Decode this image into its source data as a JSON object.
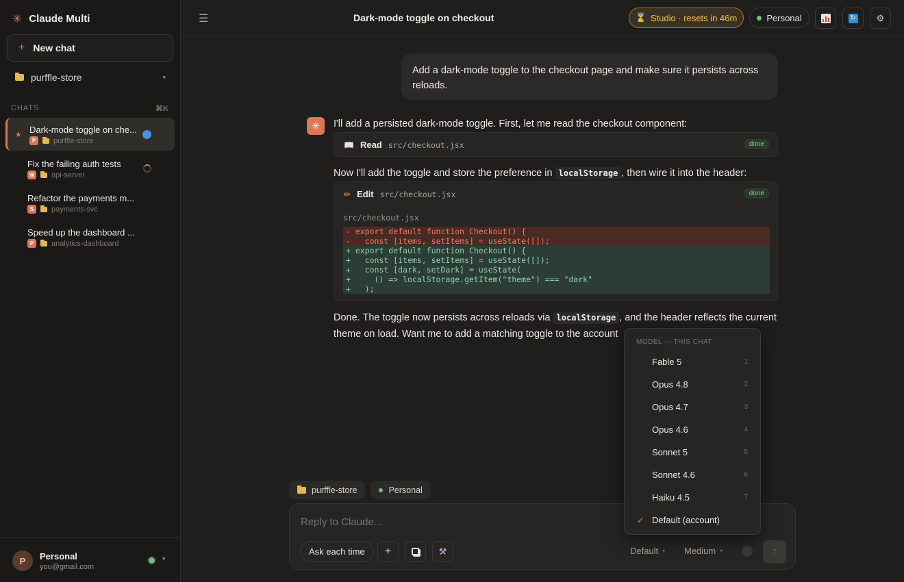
{
  "app": {
    "name": "Claude Multi",
    "logo_icon": "asterisk-icon",
    "accent": "#d97757"
  },
  "sidebar": {
    "new_chat": "New chat",
    "project": "purffle-store",
    "section_label": "CHATS",
    "section_shortcut": "⌘K",
    "chats": [
      {
        "title": "Dark-mode toggle on checkout",
        "display": "Dark-mode toggle on che...",
        "avatar": "P",
        "avatar_color": "#d97757",
        "project": "purffle-store",
        "status": "active"
      },
      {
        "title": "Fix the failing auth tests",
        "display": "Fix the failing auth tests",
        "avatar": "W",
        "avatar_color": "#d97757",
        "project": "api-server",
        "status": "running"
      },
      {
        "title": "Refactor the payments module",
        "display": "Refactor the payments m...",
        "avatar": "S",
        "avatar_color": "#d97757",
        "project": "payments-svc",
        "status": "idle"
      },
      {
        "title": "Speed up the dashboard",
        "display": "Speed up the dashboard ...",
        "avatar": "P",
        "avatar_color": "#d97757",
        "project": "analytics-dashboard",
        "status": "idle"
      }
    ],
    "user": {
      "initial": "P",
      "name": "Personal",
      "email": "you@gmail.com"
    }
  },
  "header": {
    "title": "Dark-mode toggle on checkout",
    "studio_badge": "Studio · resets in 46m",
    "account": "Personal"
  },
  "conversation": {
    "user_message": "Add a dark-mode toggle to the checkout page and make sure it persists across reloads.",
    "assistant_intro": "I'll add a persisted dark-mode toggle. First, let me read the checkout component:",
    "read_tool": {
      "verb": "Read",
      "path": "src/checkout.jsx",
      "status": "done"
    },
    "mid_text_before": "Now I'll add the toggle and store the preference in ",
    "mid_code": "localStorage",
    "mid_text_after": ", then wire it into the header:",
    "edit_tool": {
      "verb": "Edit",
      "path": "src/checkout.jsx",
      "status": "done",
      "diff_file": "src/checkout.jsx",
      "diff_lines": [
        {
          "type": "del",
          "text": "- export default function Checkout() {"
        },
        {
          "type": "del",
          "text": "-   const [items, setItems] = useState([]);"
        },
        {
          "type": "add",
          "text": "+ export default function Checkout() {"
        },
        {
          "type": "add",
          "text": "+   const [items, setItems] = useState([]);"
        },
        {
          "type": "add",
          "text": "+   const [dark, setDark] = useState("
        },
        {
          "type": "add",
          "text": "+     () => localStorage.getItem(\"theme\") === \"dark\""
        },
        {
          "type": "add",
          "text": "+   );"
        }
      ]
    },
    "final_line1_before": "Done. The toggle now persists across reloads via ",
    "final_code": "localStorage",
    "final_line1_after": ", and the header reflects the current",
    "final_line2": "theme on load. Want me to add a matching toggle to the account"
  },
  "composer": {
    "chips": [
      "purffle-store",
      "Personal"
    ],
    "placeholder": "Reply to Claude...",
    "permission": "Ask each time",
    "model_select": "Default",
    "effort_select": "Medium"
  },
  "model_menu": {
    "heading": "MODEL — THIS CHAT",
    "items": [
      {
        "label": "Fable 5",
        "shortcut": "1",
        "checked": false
      },
      {
        "label": "Opus 4.8",
        "shortcut": "2",
        "checked": false
      },
      {
        "label": "Opus 4.7",
        "shortcut": "3",
        "checked": false
      },
      {
        "label": "Opus 4.6",
        "shortcut": "4",
        "checked": false
      },
      {
        "label": "Sonnet 5",
        "shortcut": "5",
        "checked": false
      },
      {
        "label": "Sonnet 4.6",
        "shortcut": "6",
        "checked": false
      },
      {
        "label": "Haiku 4.5",
        "shortcut": "7",
        "checked": false
      },
      {
        "label": "Default (account)",
        "shortcut": "",
        "checked": true
      }
    ]
  }
}
